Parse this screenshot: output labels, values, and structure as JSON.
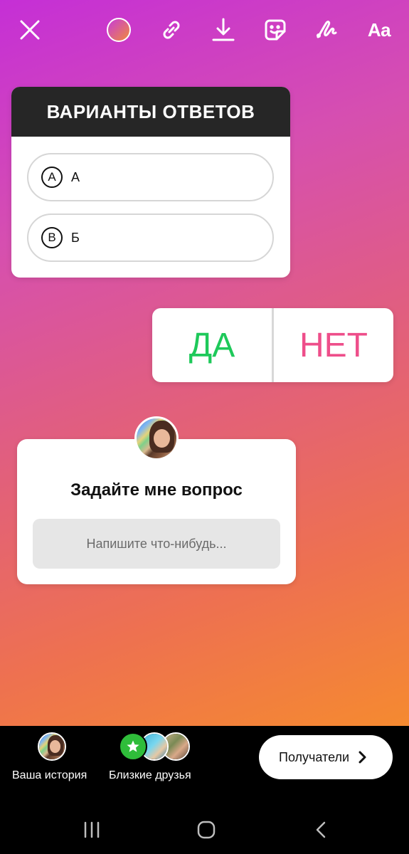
{
  "toolbar": {
    "close_icon": "close-icon",
    "color_icon": "color-picker-icon",
    "link_icon": "link-icon",
    "download_icon": "download-icon",
    "sticker_icon": "sticker-icon",
    "draw_icon": "draw-icon",
    "text_label": "Aa"
  },
  "quiz": {
    "title": "ВАРИАНТЫ ОТВЕТОВ",
    "options": [
      {
        "letter": "A",
        "text": "А"
      },
      {
        "letter": "B",
        "text": "Б"
      }
    ]
  },
  "poll": {
    "yes": "ДА",
    "no": "НЕТ",
    "yes_color": "#1ec95a",
    "no_color": "#ee4e8a"
  },
  "question": {
    "title": "Задайте мне вопрос",
    "placeholder": "Напишите что-нибудь..."
  },
  "share": {
    "your_story": "Ваша история",
    "close_friends": "Близкие друзья",
    "recipients": "Получатели"
  },
  "colors": {
    "gradient_start": "#c52fd6",
    "gradient_end": "#f58a30",
    "close_friends_green": "#2fbd3a"
  }
}
